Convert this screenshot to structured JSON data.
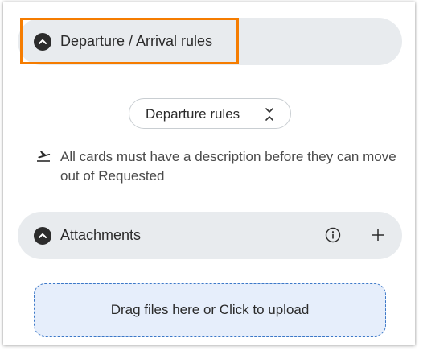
{
  "departure_section": {
    "title": "Departure / Arrival rules",
    "toggle_icon": "chevron-up-icon",
    "highlight_color": "#f57c00"
  },
  "rules_selector": {
    "label": "Departure rules",
    "icon": "expand-collapse-icon"
  },
  "rule": {
    "icon": "departure-icon",
    "text": "All cards must have a description before they can move out of Requested"
  },
  "attachments_section": {
    "title": "Attachments",
    "toggle_icon": "chevron-up-icon",
    "info_icon": "info-icon",
    "add_icon": "plus-icon"
  },
  "upload": {
    "label": "Drag files here or Click to upload"
  },
  "colors": {
    "header_bg": "#e8ebee",
    "upload_bg": "#e6eefb",
    "upload_border": "#3c78c8"
  }
}
